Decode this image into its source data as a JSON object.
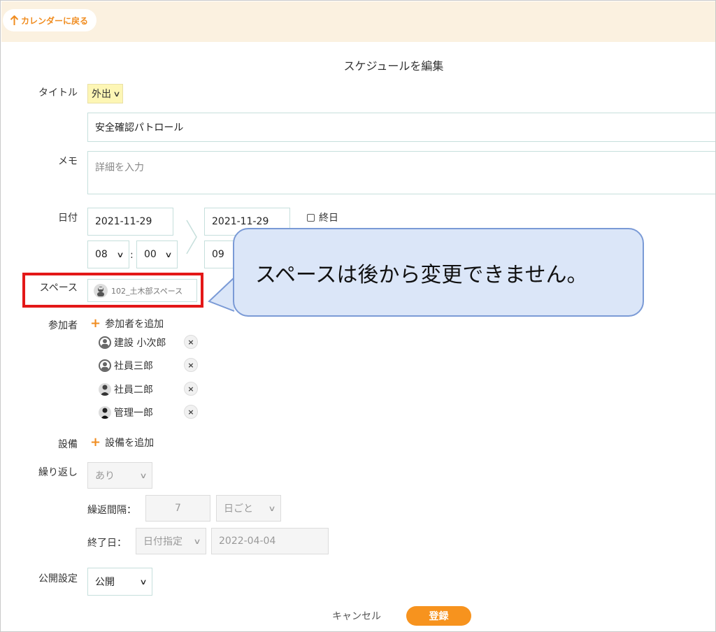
{
  "header": {
    "back_label": "カレンダーに戻る"
  },
  "page": {
    "title": "スケジュールを編集"
  },
  "title_field": {
    "label": "タイトル",
    "category_value": "外出",
    "text_value": "安全確認パトロール"
  },
  "memo": {
    "label": "メモ",
    "placeholder": "詳細を入力"
  },
  "date": {
    "label": "日付",
    "start_date": "2021-11-29",
    "end_date": "2021-11-29",
    "start_hour": "08",
    "start_minute": "00",
    "end_hour": "09",
    "time_separator": ":",
    "all_day_label": "終日"
  },
  "space": {
    "label": "スペース",
    "value": "102_土木部スペース"
  },
  "callout": {
    "text": "スペースは後から変更できません。"
  },
  "participants": {
    "label": "参加者",
    "add_label": "参加者を追加",
    "items": [
      {
        "name": "建設 小次郎"
      },
      {
        "name": "社員三郎"
      },
      {
        "name": "社員二郎"
      },
      {
        "name": "管理一郎"
      }
    ],
    "remove_icon": "×"
  },
  "equipment": {
    "label": "設備",
    "add_label": "設備を追加"
  },
  "repeat": {
    "label": "繰り返し",
    "value": "あり",
    "interval_label": "繰返間隔：",
    "interval_value": "7",
    "interval_unit": "日ごと",
    "end_label": "終了日：",
    "end_type": "日付指定",
    "end_date": "2022-04-04"
  },
  "visibility": {
    "label": "公開設定",
    "value": "公開"
  },
  "footer": {
    "cancel_label": "キャンセル",
    "submit_label": "登録"
  },
  "colors": {
    "accent": "#f7931e",
    "highlight_border": "#e31818",
    "callout_fill": "#dbe6f8",
    "callout_border": "#7a9ad6",
    "header_bg": "#fbf1e0",
    "title_select_bg": "#fdf6b5"
  },
  "icons": {
    "back": "arrow-up-icon",
    "add": "plus-icon",
    "remove": "close-icon",
    "avatar": "user-icon",
    "dropdown": "chevron-down-icon"
  }
}
